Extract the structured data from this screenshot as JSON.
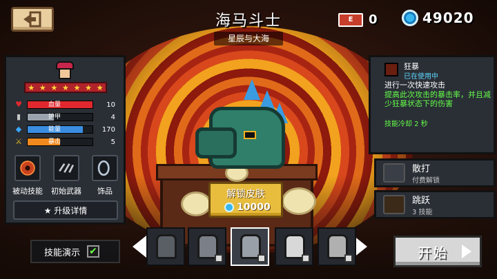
{
  "header": {
    "title": "海马斗士",
    "subtitle": "星辰与大海",
    "ticket_count": "0",
    "ticket_icon_text": "E",
    "gems": "49020"
  },
  "left_panel": {
    "stars": [
      "★",
      "★",
      "★",
      "★",
      "★",
      "★",
      "★"
    ],
    "stats": [
      {
        "label": "血量",
        "value": "10",
        "fill_pct": 100,
        "color": "#e0282e"
      },
      {
        "label": "护甲",
        "value": "4",
        "fill_pct": 40,
        "color": "#9aa3ad"
      },
      {
        "label": "能量",
        "value": "170",
        "fill_pct": 85,
        "color": "#3a8de0"
      },
      {
        "label": "暴击",
        "value": "5",
        "fill_pct": 50,
        "color": "#f08a1e"
      }
    ],
    "slots": [
      {
        "label": "被动技能"
      },
      {
        "label": "初始武器"
      },
      {
        "label": "饰品"
      }
    ],
    "upgrade_label": "★ 升级详情"
  },
  "skill": {
    "name": "狂暴",
    "status": "已在使用中",
    "desc": "进行一次快速攻击",
    "effect": "提高此次攻击的暴击率，并且减少狂暴状态下的伤害",
    "cooldown": "技能冷却 2 秒"
  },
  "right_buttons": [
    {
      "name": "散打",
      "sub": "付费解锁"
    },
    {
      "name": "跳跃",
      "sub": "3 技能"
    }
  ],
  "unlock": {
    "label": "解锁皮肤",
    "price": "10000"
  },
  "bottom": {
    "demo_label": "技能演示",
    "demo_checked": "✔",
    "start_label": "开始"
  }
}
